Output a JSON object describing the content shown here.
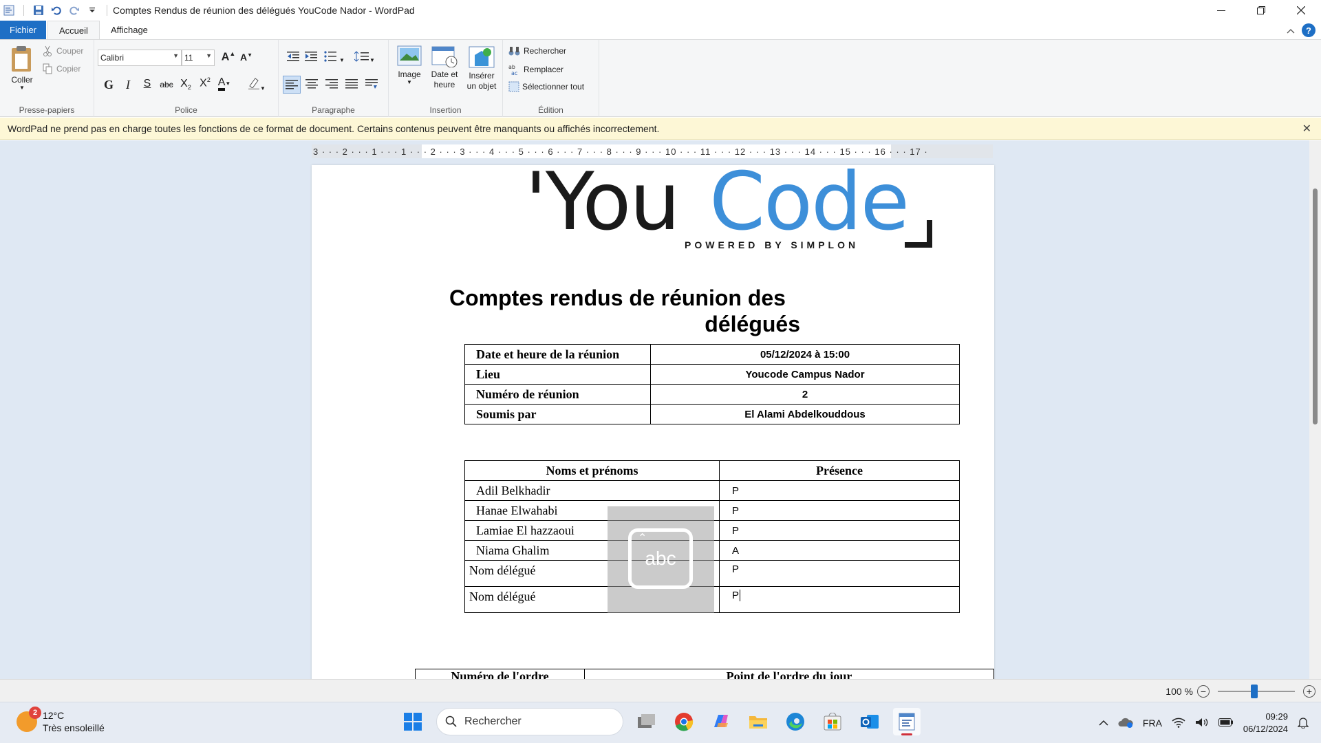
{
  "window": {
    "title": "Comptes Rendus de réunion des délégués YouCode Nador - WordPad",
    "controls": [
      "minimize-icon",
      "restore-icon",
      "close-icon"
    ]
  },
  "tabs": {
    "file": "Fichier",
    "home": "Accueil",
    "view": "Affichage"
  },
  "ribbon": {
    "clipboard": {
      "paste": "Coller",
      "cut": "Couper",
      "copy": "Copier",
      "label": "Presse-papiers"
    },
    "font": {
      "family": "Calibri",
      "size": "11",
      "label": "Police",
      "bold": "G",
      "italic": "I",
      "strike": "S",
      "abc": "abc"
    },
    "paragraph": {
      "label": "Paragraphe"
    },
    "insert": {
      "image": "Image",
      "datetime_1": "Date et",
      "datetime_2": "heure",
      "object_1": "Insérer",
      "object_2": "un objet",
      "label": "Insertion"
    },
    "edit": {
      "find": "Rechercher",
      "replace": "Remplacer",
      "select_all": "Sélectionner tout",
      "label": "Édition"
    }
  },
  "infobar": {
    "message": "WordPad ne prend pas en charge toutes les fonctions de ce format de document. Certains contenus peuvent être manquants ou affichés incorrectement."
  },
  "ruler": "3 · · · 2 · · · 1 · · · 1 · · · 2 · · · 3 · · · 4 · · · 5 · · · 6 · · · 7 · · · 8 · · · 9 · · · 10 · · · 11 · · · 12 · · · 13 · · · 14 · · · 15 · · · 16 · · · 17 ·",
  "document": {
    "logo": {
      "you": "'You",
      "code": "Code",
      "powered": "POWERED BY SIMPLON"
    },
    "title_line1": "Comptes rendus de réunion des",
    "title_line2": "délégués",
    "meeting": [
      {
        "label": "Date et heure de la réunion",
        "value": "05/12/2024  à 15:00"
      },
      {
        "label": "Lieu",
        "value": "Youcode Campus Nador"
      },
      {
        "label": "Numéro  de réunion",
        "value": "2"
      },
      {
        "label": "Soumis  par",
        "value": "El Alami Abdelkouddous"
      }
    ],
    "attendance_headers": {
      "name": "Noms  et prénoms",
      "presence": "Présence"
    },
    "attendance": [
      {
        "name": "Adil Belkhadir",
        "presence": "P"
      },
      {
        "name": "Hanae Elwahabi",
        "presence": "P"
      },
      {
        "name": "Lamiae El hazzaoui",
        "presence": "P"
      },
      {
        "name": "Niama Ghalim",
        "presence": "A"
      },
      {
        "name": "Nom délégué",
        "presence": "P"
      },
      {
        "name": "Nom délégué",
        "presence": "P"
      }
    ],
    "agenda_headers": {
      "number": "Numéro  de l'ordre",
      "point": "Point de l'ordre  du  jour"
    }
  },
  "ime_overlay": {
    "text": "abc"
  },
  "status": {
    "zoom": "100 %"
  },
  "taskbar": {
    "weather_temp": "12°C",
    "weather_desc": "Très ensoleillé",
    "weather_badge": "2",
    "search": "Rechercher",
    "lang": "FRA",
    "time": "09:29",
    "date": "06/12/2024"
  }
}
